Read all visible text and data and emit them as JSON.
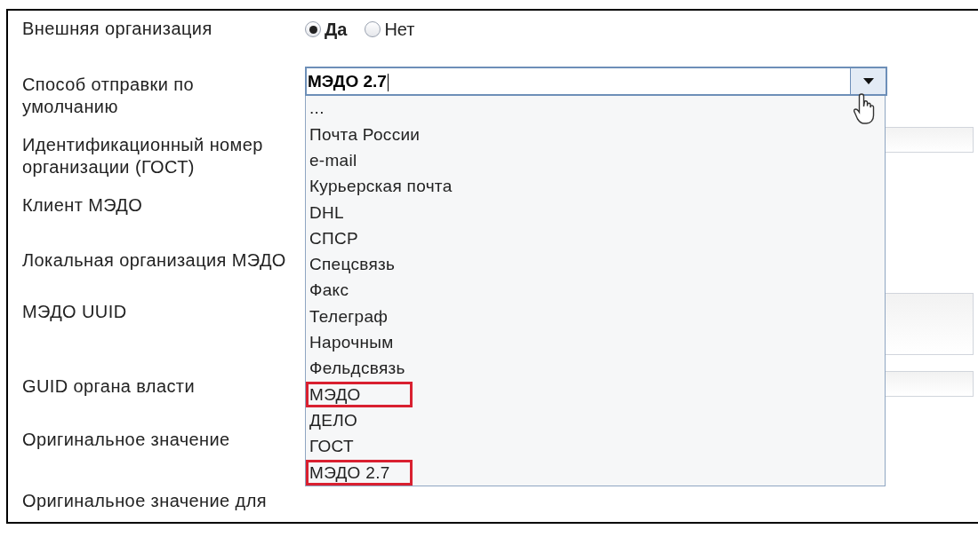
{
  "form": {
    "fields": [
      {
        "label": "Внешняя организация",
        "kind": "radio",
        "options": [
          {
            "label": "Да",
            "selected": true
          },
          {
            "label": "Нет",
            "selected": false
          }
        ]
      },
      {
        "label": "Способ отправки по умолчанию",
        "kind": "combo",
        "value": "МЭДО 2.7",
        "expanded": true
      },
      {
        "label": "Идентификационный номер организации (ГОСТ)",
        "kind": "text"
      },
      {
        "label": "Клиент МЭДО",
        "kind": "covered"
      },
      {
        "label": "Локальная организация МЭДО",
        "kind": "covered"
      },
      {
        "label": "МЭДО UUID",
        "kind": "textarea"
      },
      {
        "label": "GUID органа власти",
        "kind": "text"
      },
      {
        "label": "Оригинальное значение",
        "kind": "covered"
      },
      {
        "label": "Оригинальное значение для",
        "kind": "covered"
      }
    ]
  },
  "dropdown": {
    "items": [
      {
        "label": "...",
        "highlighted": false
      },
      {
        "label": "Почта России",
        "highlighted": false
      },
      {
        "label": "e-mail",
        "highlighted": false
      },
      {
        "label": "Курьерская почта",
        "highlighted": false
      },
      {
        "label": "DHL",
        "highlighted": false
      },
      {
        "label": "СПСР",
        "highlighted": false
      },
      {
        "label": "Спецсвязь",
        "highlighted": false
      },
      {
        "label": "Факс",
        "highlighted": false
      },
      {
        "label": "Телеграф",
        "highlighted": false
      },
      {
        "label": "Нарочным",
        "highlighted": false
      },
      {
        "label": "Фельдсвязь",
        "highlighted": false
      },
      {
        "label": "МЭДО",
        "highlighted": true
      },
      {
        "label": "ДЕЛО",
        "highlighted": false
      },
      {
        "label": "ГОСТ",
        "highlighted": false
      },
      {
        "label": "МЭДО 2.7",
        "highlighted": true
      }
    ]
  }
}
